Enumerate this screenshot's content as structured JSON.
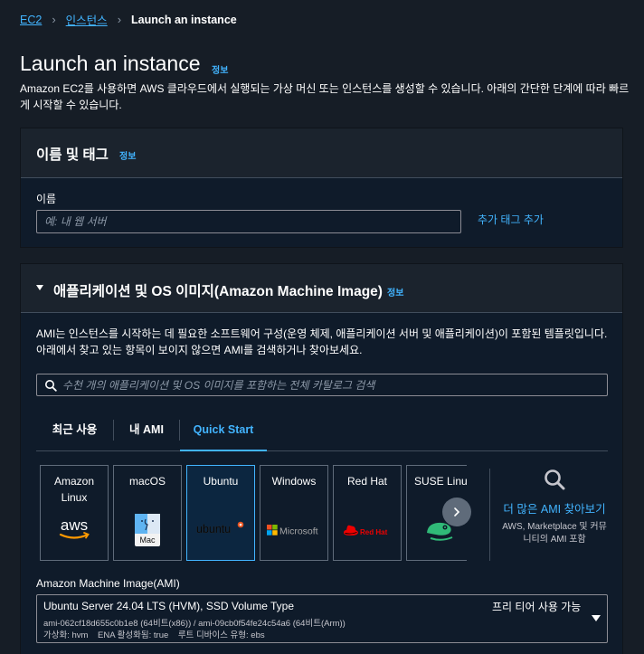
{
  "breadcrumb": {
    "items": [
      "EC2",
      "인스턴스"
    ],
    "current": "Launch an instance"
  },
  "page": {
    "title": "Launch an instance",
    "info": "정보",
    "description": "Amazon EC2를 사용하면 AWS 클라우드에서 실행되는 가상 머신 또는 인스턴스를 생성할 수 있습니다. 아래의 간단한 단계에 따라 빠르게 시작할 수 있습니다."
  },
  "name_panel": {
    "title": "이름 및 태그",
    "info": "정보",
    "name_label": "이름",
    "name_placeholder": "예: 내 웹 서버",
    "name_value": "",
    "add_tag": "추가 태그 추가"
  },
  "ami_panel": {
    "title": "애플리케이션 및 OS 이미지(Amazon Machine Image)",
    "info": "정보",
    "description": "AMI는 인스턴스를 시작하는 데 필요한 소프트웨어 구성(운영 체제, 애플리케이션 서버 및 애플리케이션)이 포함된 템플릿입니다. 아래에서 찾고 있는 항목이 보이지 않으면 AMI를 검색하거나 찾아보세요.",
    "search_placeholder": "수천 개의 애플리케이션 및 OS 이미지를 포함하는 전체 카탈로그 검색",
    "tabs": [
      {
        "label": "최근 사용",
        "active": false
      },
      {
        "label": "내 AMI",
        "active": false
      },
      {
        "label": "Quick Start",
        "active": true
      }
    ],
    "os_cards": [
      {
        "name": "Amazon Linux",
        "logo_text": "aws",
        "icon": "aws-logo-icon",
        "selected": false
      },
      {
        "name": "macOS",
        "logo_text": "Mac",
        "icon": "mac-finder-icon",
        "selected": false
      },
      {
        "name": "Ubuntu",
        "logo_text": "ubuntu",
        "icon": "ubuntu-logo-icon",
        "selected": true
      },
      {
        "name": "Windows",
        "logo_text": "Microsoft",
        "icon": "microsoft-logo-icon",
        "selected": false
      },
      {
        "name": "Red Hat",
        "logo_text": "Red Hat",
        "icon": "redhat-logo-icon",
        "selected": false
      },
      {
        "name": "SUSE Linux",
        "logo_text": "",
        "icon": "suse-logo-icon",
        "selected": false
      }
    ],
    "more_ami": {
      "link": "더 많은 AMI 찾아보기",
      "sub": "AWS, Marketplace 및 커뮤니티의 AMI 포함"
    },
    "ami_select": {
      "label": "Amazon Machine Image(AMI)",
      "name": "Ubuntu Server 24.04 LTS (HVM), SSD Volume Type",
      "free_tier": "프리 티어 사용 가능",
      "ids": "ami-062cf18d655c0b1e8 (64비트(x86)) / ami-09cb0f54fe24c54a6 (64비트(Arm))",
      "meta": "가상화: hvm    ENA 활성화됨: true    루트 디바이스 유형: ebs"
    }
  },
  "colors": {
    "background": "#161d26",
    "link": "#42b4ff",
    "panel_header": "#1b232d",
    "panel_body": "#0f1b2a",
    "border": "#414d5c",
    "selected_card_border": "#42b4ff"
  }
}
